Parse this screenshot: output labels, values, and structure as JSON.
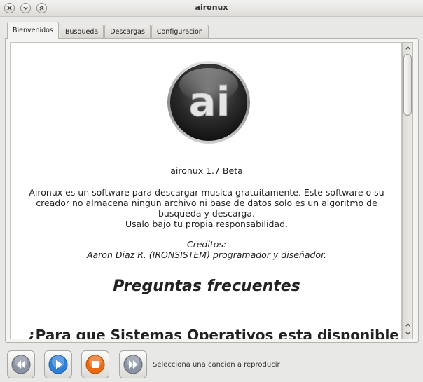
{
  "window": {
    "title": "aironux"
  },
  "tabs": [
    {
      "label": "Bienvenidos",
      "active": true
    },
    {
      "label": "Busqueda",
      "active": false
    },
    {
      "label": "Descargas",
      "active": false
    },
    {
      "label": "Configuracion",
      "active": false
    }
  ],
  "welcome": {
    "logo_text": "ai",
    "version": "aironux 1.7 Beta",
    "description_lines": [
      "Aironux es un software para descargar musica gratuitamente. Este software o su",
      "creador no almacena ningun archivo ni base de datos solo es un algoritmo de",
      "busqueda y descarga.",
      "Usalo bajo tu propia responsabilidad."
    ],
    "credits_title": "Creditos:",
    "credits_text": "Aaron Diaz R. (IRONSISTEM) programador y diseñador.",
    "faq_heading": "Preguntas frecuentes",
    "faq_question_1": "¿Para que Sistemas Operativos esta disponible"
  },
  "player": {
    "status": "Selecciona una cancion a reproducir",
    "buttons": [
      "previous",
      "play",
      "stop",
      "next"
    ]
  },
  "colors": {
    "play_blue": "#2f7fd6",
    "stop_orange": "#ea6a12",
    "nav_gray": "#8a93a3"
  }
}
